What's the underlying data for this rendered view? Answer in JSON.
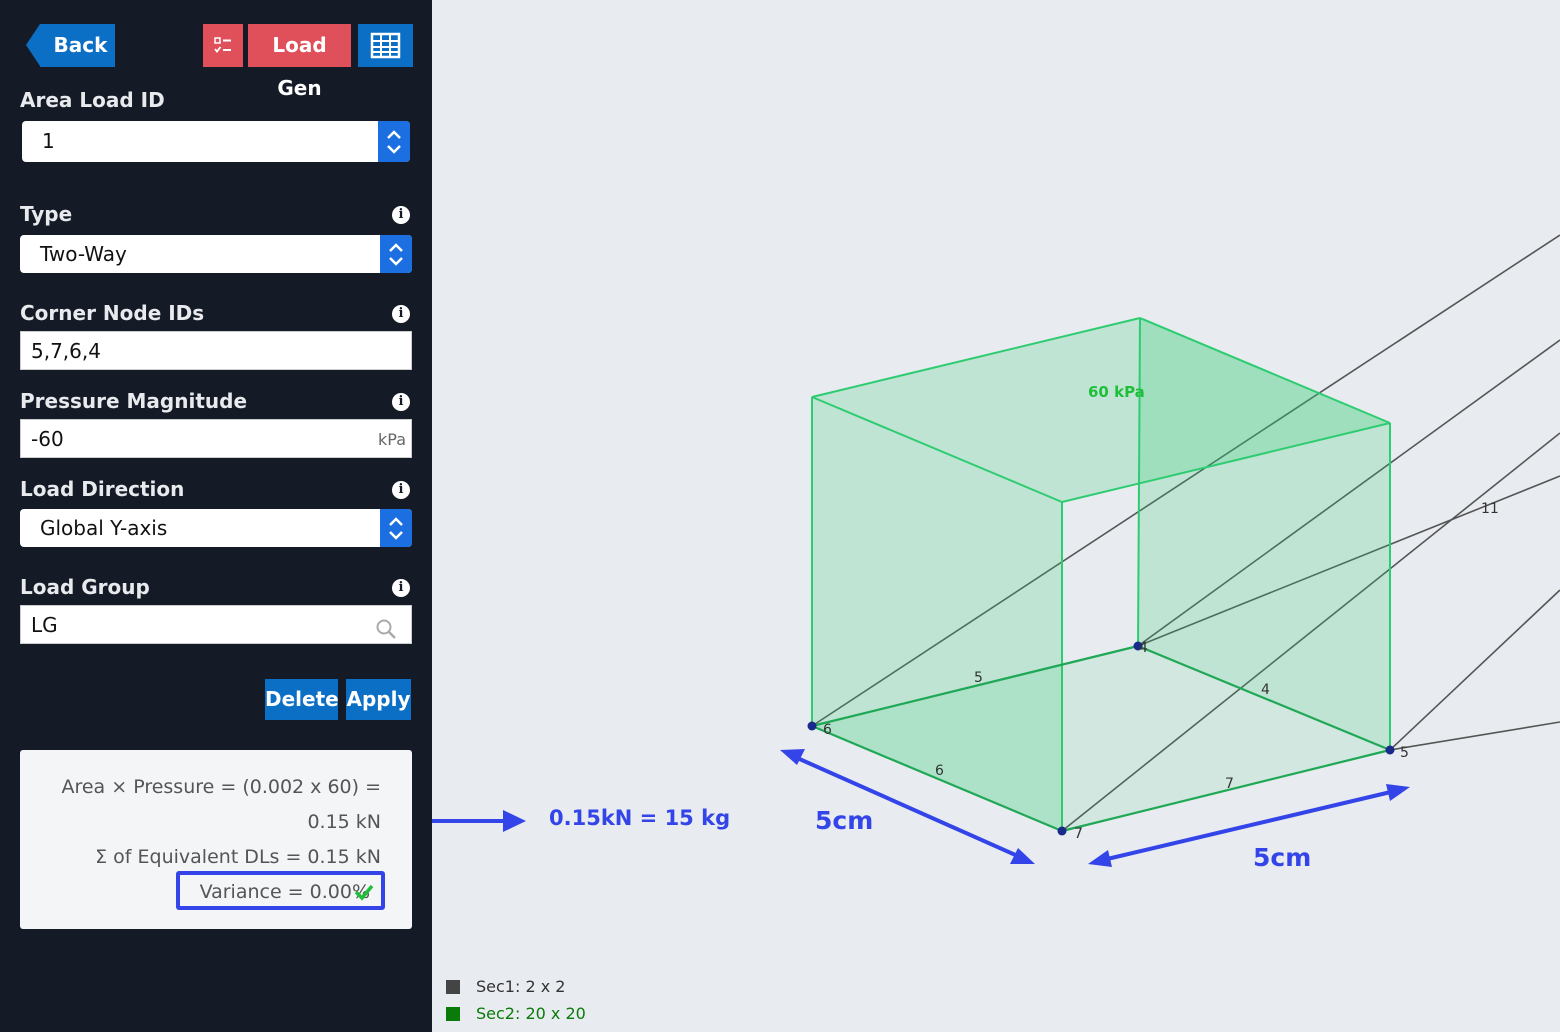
{
  "toolbar": {
    "back_label": "Back",
    "loadgen_label": "Load Gen"
  },
  "form": {
    "area_load_id": {
      "label": "Area Load ID",
      "value": "1"
    },
    "type": {
      "label": "Type",
      "value": "Two-Way"
    },
    "corner_nodes": {
      "label": "Corner Node IDs",
      "value": "5,7,6,4"
    },
    "pressure": {
      "label": "Pressure Magnitude",
      "value": "-60",
      "unit": "kPa"
    },
    "direction": {
      "label": "Load Direction",
      "value": "Global Y-axis"
    },
    "group": {
      "label": "Load Group",
      "value": "LG"
    },
    "delete_label": "Delete",
    "apply_label": "Apply"
  },
  "summary": {
    "line1": "Area × Pressure = (0.002 x 60) =",
    "line2": "0.15 kN",
    "line3": "Σ of Equivalent DLs = 0.15 kN",
    "variance": "Variance = 0.00%"
  },
  "annotations": {
    "weight": "0.15kN = 15 kg",
    "dim_left": "5cm",
    "dim_right": "5cm"
  },
  "model": {
    "pressure_label": "60 kPa",
    "nodes": [
      "4",
      "5",
      "6",
      "7"
    ],
    "members": [
      "4",
      "5",
      "6",
      "7",
      "11"
    ]
  },
  "legend": [
    {
      "label": "Sec1: 2 x 2",
      "color": "#444444"
    },
    {
      "label": "Sec2: 20 x 20",
      "color": "#0a7a0a"
    }
  ],
  "colors": {
    "accent_blue": "#0b6fc6",
    "red": "#e0505a",
    "annotation": "#3345e8",
    "load_green": "#2ecc71"
  }
}
